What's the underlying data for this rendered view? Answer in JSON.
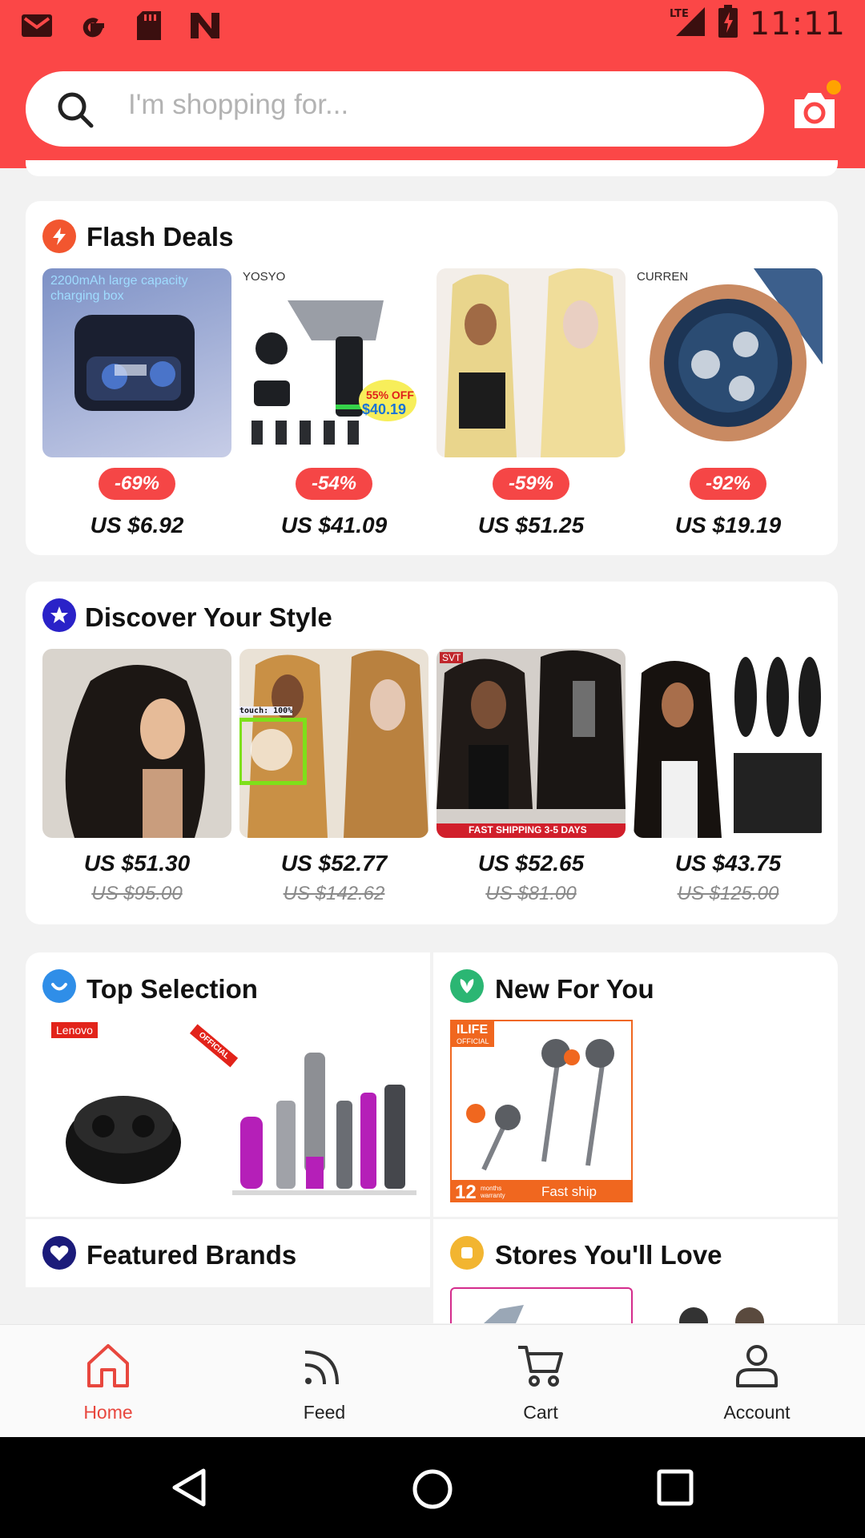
{
  "status_bar": {
    "time": "11:11",
    "left_icons": [
      "gmail-icon",
      "google-icon",
      "sd-card-icon",
      "app-n-icon"
    ],
    "right_icons": [
      "lte-signal-icon",
      "battery-charging-icon"
    ]
  },
  "search": {
    "placeholder": "I'm shopping for..."
  },
  "colors": {
    "brand": "#fb4747",
    "discount": "#f54646",
    "nav_active": "#e8473e"
  },
  "flash_deals": {
    "title": "Flash Deals",
    "items": [
      {
        "discount": "-69%",
        "price": "US $6.92",
        "image": "earbuds-charging-box",
        "image_text": "2200mAh large capacity charging box"
      },
      {
        "discount": "-54%",
        "price": "US $41.09",
        "image": "massage-gun",
        "image_text": "YOSYO",
        "badge_off": "55% OFF",
        "badge_price": "$40.19"
      },
      {
        "discount": "-59%",
        "price": "US $51.25",
        "image": "blonde-wig"
      },
      {
        "discount": "-92%",
        "price": "US $19.19",
        "image": "wrist-watch",
        "image_text": "CURREN"
      }
    ]
  },
  "discover": {
    "title": "Discover Your Style",
    "items": [
      {
        "price": "US $51.30",
        "old_price": "US $95.00",
        "image": "curly-wig"
      },
      {
        "price": "US $52.77",
        "old_price": "US $142.62",
        "image": "highlight-wig",
        "overlay": "touch: 100%"
      },
      {
        "price": "US $52.65",
        "old_price": "US $81.00",
        "image": "deep-wave-wig",
        "banner": "FAST SHIPPING 3-5 DAYS",
        "image_text": "SVT"
      },
      {
        "price": "US $43.75",
        "old_price": "US $125.00",
        "image": "body-wave-bundles"
      }
    ]
  },
  "top_selection": {
    "title": "Top Selection",
    "brand_tag": "Lenovo",
    "ribbon": "OFFICIAL"
  },
  "new_for_you": {
    "title": "New For You",
    "brand_tag": "ILIFE",
    "brand_sub": "OFFICIAL",
    "warranty": "12",
    "warranty_sub": "months warranty",
    "ship": "Fast ship"
  },
  "featured_brands": {
    "title": "Featured Brands"
  },
  "stores": {
    "title": "Stores You'll Love"
  },
  "bottom_nav": [
    {
      "label": "Home",
      "icon": "home-icon",
      "active": true
    },
    {
      "label": "Feed",
      "icon": "feed-icon",
      "active": false
    },
    {
      "label": "Cart",
      "icon": "cart-icon",
      "active": false
    },
    {
      "label": "Account",
      "icon": "account-icon",
      "active": false
    }
  ],
  "system_nav": [
    "back-icon",
    "home-circle-icon",
    "recents-icon"
  ]
}
